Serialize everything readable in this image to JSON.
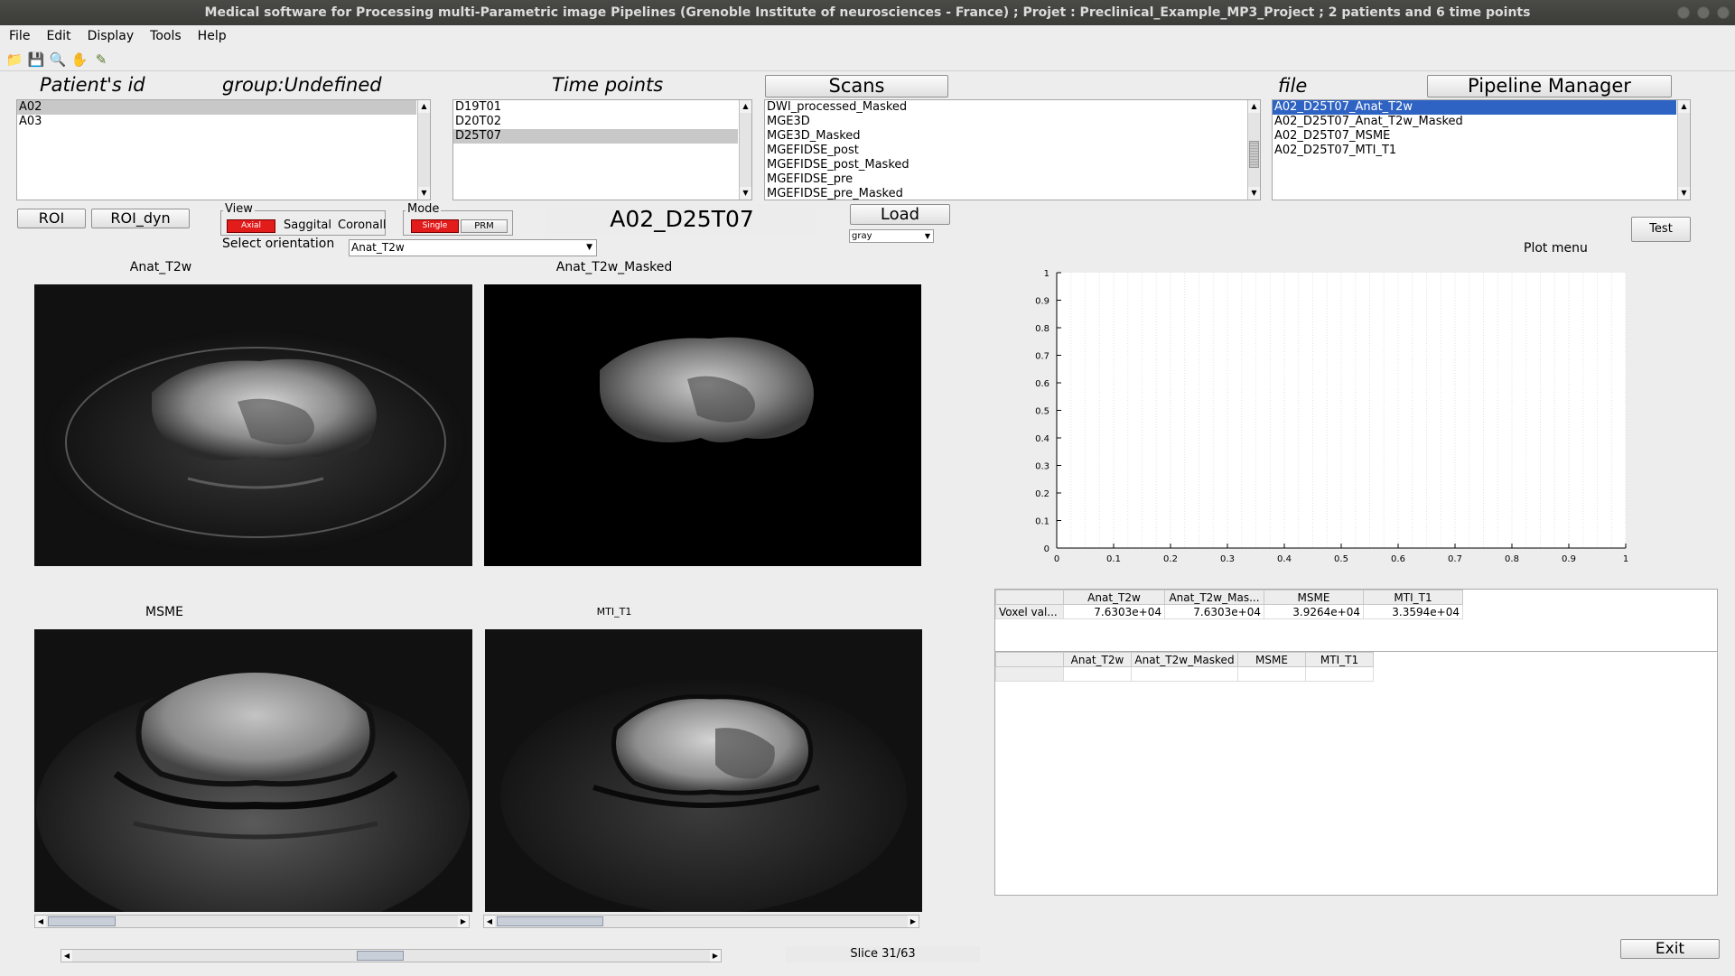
{
  "window": {
    "title": "Medical software for Processing multi-Parametric image Pipelines (Grenoble Institute of neurosciences - France) ; Projet : Preclinical_Example_MP3_Project ; 2 patients and 6 time points"
  },
  "menu": [
    "File",
    "Edit",
    "Display",
    "Tools",
    "Help"
  ],
  "toolbar_icons": [
    "open-folder-icon",
    "save-icon",
    "zoom-icon",
    "pan-hand-icon",
    "data-cursor-icon"
  ],
  "headers": {
    "patient_id": "Patient's id",
    "group": "group:Undefined",
    "time_points": "Time points",
    "scans": "Scans",
    "file": "file",
    "pipeline_manager": "Pipeline Manager"
  },
  "patients": [
    {
      "label": "A02",
      "selected": true
    },
    {
      "label": "A03",
      "selected": false
    }
  ],
  "time_points": [
    {
      "label": "D19T01",
      "selected": false
    },
    {
      "label": "D20T02",
      "selected": false
    },
    {
      "label": "D25T07",
      "selected": true
    }
  ],
  "scans": [
    "DWI_processed_Masked",
    "MGE3D",
    "MGE3D_Masked",
    "MGEFIDSE_post",
    "MGEFIDSE_post_Masked",
    "MGEFIDSE_pre",
    "MGEFIDSE_pre_Masked"
  ],
  "files": [
    {
      "label": "A02_D25T07_Anat_T2w",
      "selected": true
    },
    {
      "label": "A02_D25T07_Anat_T2w_Masked",
      "selected": false
    },
    {
      "label": "A02_D25T07_MSME",
      "selected": false
    },
    {
      "label": "A02_D25T07_MTI_T1",
      "selected": false
    }
  ],
  "controls": {
    "roi": "ROI",
    "roi_dyn": "ROI_dyn",
    "view_label": "View",
    "axial": "Axial",
    "saggital": "Saggital",
    "coronall": "Coronall",
    "mode_label": "Mode",
    "single": "Single",
    "prm": "PRM",
    "select_orientation": "Select orientation",
    "orientation_value": "Anat_T2w",
    "current_scan": "A02_D25T07",
    "load": "Load",
    "colormap": "gray",
    "test": "Test",
    "plot_menu": "Plot menu",
    "exit": "Exit",
    "slice": "Slice 31/63"
  },
  "images": [
    {
      "title": "Anat_T2w"
    },
    {
      "title": "Anat_T2w_Masked"
    },
    {
      "title": "MSME"
    },
    {
      "title": "MTI_T1"
    }
  ],
  "chart_data": {
    "type": "line",
    "title": "",
    "xlabel": "",
    "ylabel": "",
    "xlim": [
      0,
      1
    ],
    "ylim": [
      0,
      1
    ],
    "xticks": [
      "0",
      "0.1",
      "0.2",
      "0.3",
      "0.4",
      "0.5",
      "0.6",
      "0.7",
      "0.8",
      "0.9",
      "1"
    ],
    "yticks": [
      "0",
      "0.1",
      "0.2",
      "0.3",
      "0.4",
      "0.5",
      "0.6",
      "0.7",
      "0.8",
      "0.9",
      "1"
    ],
    "grid": "vertical-dotted",
    "series": []
  },
  "voxel_table": {
    "columns": [
      "",
      "Anat_T2w",
      "Anat_T2w_Mas...",
      "MSME",
      "MTI_T1"
    ],
    "rows": [
      [
        "Voxel val...",
        "7.6303e+04",
        "7.6303e+04",
        "3.9264e+04",
        "3.3594e+04"
      ]
    ]
  },
  "roi_table": {
    "columns": [
      "",
      "Anat_T2w",
      "Anat_T2w_Masked",
      "MSME",
      "MTI_T1"
    ],
    "rows": [
      [
        "",
        "",
        "",
        "",
        ""
      ]
    ]
  }
}
